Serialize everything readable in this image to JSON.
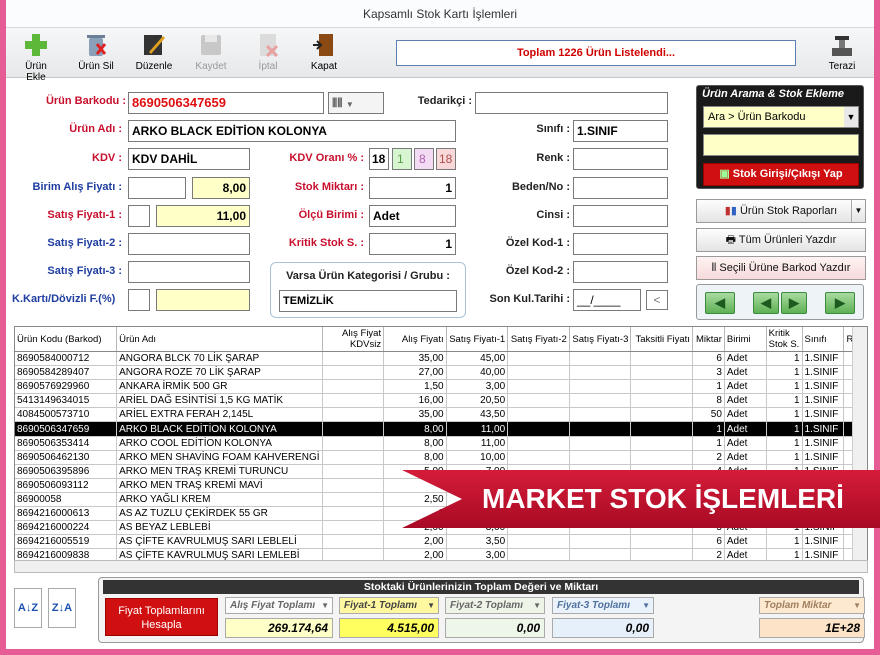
{
  "window": {
    "title": "Kapsamlı Stok Kartı İşlemleri"
  },
  "toolbar": {
    "buttons": [
      {
        "label": "Ürün Ekle",
        "icon": "plus-icon"
      },
      {
        "label": "Ürün Sil",
        "icon": "trash-icon"
      },
      {
        "label": "Düzenle",
        "icon": "edit-icon"
      },
      {
        "label": "Kaydet",
        "icon": "save-icon"
      },
      {
        "label": "İptal",
        "icon": "cancel-icon"
      },
      {
        "label": "Kapat",
        "icon": "exit-door-icon"
      }
    ],
    "status": "Toplam 1226 Ürün Listelendi...",
    "scale_label": "Terazi"
  },
  "form": {
    "barkod_label": "Ürün Barkodu :",
    "barkod": "8690506347659",
    "tedarikci_label": "Tedarikçi :",
    "tedarikci": "",
    "urun_adi_label": "Ürün Adı :",
    "urun_adi": "ARKO BLACK EDİTİON KOLONYA",
    "sinif_label": "Sınıfı :",
    "sinif": "1.SINIF",
    "kdv_label": "KDV :",
    "kdv": "KDV DAHİL",
    "kdv_orani_label": "KDV Oranı % :",
    "kdv_oranlari": [
      "18",
      "1",
      "8",
      "18"
    ],
    "renk_label": "Renk :",
    "renk": "",
    "alis_label": "Birim Alış Fiyatı :",
    "alis_kdvsiz": "",
    "alis": "8,00",
    "stok_label": "Stok Miktarı :",
    "stok": "1",
    "beden_label": "Beden/No :",
    "beden": "",
    "satis1_label": "Satış Fiyatı-1 :",
    "satis1_pct": "",
    "satis1": "11,00",
    "olcu_label": "Ölçü Birimi :",
    "olcu": "Adet",
    "cinsi_label": "Cinsi :",
    "cinsi": "",
    "satis2_label": "Satış Fiyatı-2 :",
    "satis2": "",
    "kritik_label": "Kritik Stok S. :",
    "kritik": "1",
    "ozel1_label": "Özel Kod-1 :",
    "ozel1": "",
    "satis3_label": "Satış Fiyatı-3 :",
    "satis3": "",
    "kategori_label": "Varsa Ürün Kategorisi / Grubu :",
    "kategori": "TEMİZLİK",
    "ozel2_label": "Özel Kod-2 :",
    "ozel2": "",
    "doviz_label": "K.Kartı/Dövizli F.(%)",
    "doviz_a": "",
    "doviz_b": "",
    "skt_label": "Son Kul.Tarihi :",
    "skt": "__/____",
    "skt_btn": "<"
  },
  "search_panel": {
    "title": "Ürün Arama & Stok Ekleme",
    "mode": "Ara > Ürün Barkodu",
    "input": "",
    "action": "Stok Girişi/Çıkışı Yap"
  },
  "side_buttons": {
    "reports": "Ürün Stok Raporları",
    "print_all": "Tüm Ürünleri Yazdır",
    "print_barcode": "Seçili Ürüne Barkod Yazdır"
  },
  "table": {
    "headers": [
      "Ürün Kodu (Barkod)",
      "Ürün Adı",
      "Alış Fiyat KDVsiz",
      "Alış Fiyatı",
      "Satış Fiyatı-1",
      "Satış Fiyatı-2",
      "Satış Fiyatı-3",
      "Taksitli Fiyatı",
      "Miktar",
      "Birimi",
      "Kritik Stok S.",
      "Sınıfı",
      "Ren"
    ],
    "rows": [
      [
        "8690584000712",
        "ANGORA BLCK 70 LİK ŞARAP",
        "",
        "35,00",
        "45,00",
        "",
        "",
        "",
        "6",
        "Adet",
        "1",
        "1.SINIF",
        ""
      ],
      [
        "8690584289407",
        "ANGORA ROZE 70 LİK ŞARAP",
        "",
        "27,00",
        "40,00",
        "",
        "",
        "",
        "3",
        "Adet",
        "1",
        "1.SINIF",
        ""
      ],
      [
        "8690576929960",
        "ANKARA İRMİK 500 GR",
        "",
        "1,50",
        "3,00",
        "",
        "",
        "",
        "1",
        "Adet",
        "1",
        "1.SINIF",
        ""
      ],
      [
        "5413149634015",
        "ARİEL DAĞ ESİNTİSİ 1,5 KG MATİK",
        "",
        "16,00",
        "20,50",
        "",
        "",
        "",
        "8",
        "Adet",
        "1",
        "1.SINIF",
        ""
      ],
      [
        "4084500573710",
        "ARİEL EXTRA FERAH 2,145L",
        "",
        "35,00",
        "43,50",
        "",
        "",
        "",
        "50",
        "Adet",
        "1",
        "1.SINIF",
        ""
      ],
      [
        "8690506347659",
        "ARKO BLACK EDİTİON KOLONYA",
        "",
        "8,00",
        "11,00",
        "",
        "",
        "",
        "1",
        "Adet",
        "1",
        "1.SINIF",
        ""
      ],
      [
        "8690506353414",
        "ARKO COOL EDİTİON KOLONYA",
        "",
        "8,00",
        "11,00",
        "",
        "",
        "",
        "1",
        "Adet",
        "1",
        "1.SINIF",
        ""
      ],
      [
        "8690506462130",
        "ARKO MEN SHAVİNG FOAM KAHVERENGİ",
        "",
        "8,00",
        "10,00",
        "",
        "",
        "",
        "2",
        "Adet",
        "1",
        "1.SINIF",
        ""
      ],
      [
        "8690506395896",
        "ARKO MEN TRAŞ KREMİ TURUNCU",
        "",
        "5,00",
        "7,00",
        "",
        "",
        "",
        "4",
        "Adet",
        "1",
        "1.SINIF",
        ""
      ],
      [
        "8690506093112",
        "ARKO MEN TRAŞ KREMİ MAVİ",
        "",
        "",
        "",
        "",
        "",
        "",
        "",
        "",
        "",
        "",
        ""
      ],
      [
        "86900058",
        "ARKO YAĞLI KREM",
        "",
        "2,50",
        "",
        "",
        "",
        "",
        "",
        "",
        "",
        "",
        ""
      ],
      [
        "8694216000613",
        "AS AZ TUZLU ÇEKİRDEK 55 GR",
        "",
        "1",
        "",
        "",
        "",
        "",
        "",
        "",
        "",
        "",
        ""
      ],
      [
        "8694216000224",
        "AS BEYAZ LEBLEBİ",
        "",
        "2,00",
        "3,00",
        "",
        "",
        "",
        "5",
        "Adet",
        "1",
        "1.SINIF",
        ""
      ],
      [
        "8694216005519",
        "AS ÇİFTE KAVRULMUŞ SARI LEBLELİ",
        "",
        "2,00",
        "3,50",
        "",
        "",
        "",
        "6",
        "Adet",
        "1",
        "1.SINIF",
        ""
      ],
      [
        "8694216009838",
        "AS ÇİFTE KAVRULMUŞ SARI LEMLEBİ",
        "",
        "2,00",
        "3,00",
        "",
        "",
        "",
        "2",
        "Adet",
        "1",
        "1.SINIF",
        ""
      ]
    ],
    "selected_row": 5
  },
  "banner": "MARKET STOK İŞLEMLERİ",
  "summary": {
    "title": "Stoktaki Ürünlerinizin Toplam Değeri ve Miktarı",
    "button": "Fiyat Toplamlarını Hesapla",
    "alis_label": "Alış Fiyat Toplamı",
    "alis": "269.174,64",
    "f1_label": "Fiyat-1 Toplamı",
    "f1": "4.515,00",
    "f2_label": "Fiyat-2 Toplamı",
    "f2": "0,00",
    "f3_label": "Fiyat-3 Toplamı",
    "f3": "0,00",
    "miktar_label": "Toplam Miktar",
    "miktar": "1E+28"
  },
  "sort": {
    "asc": "A↓Z",
    "desc": "Z↓A"
  }
}
